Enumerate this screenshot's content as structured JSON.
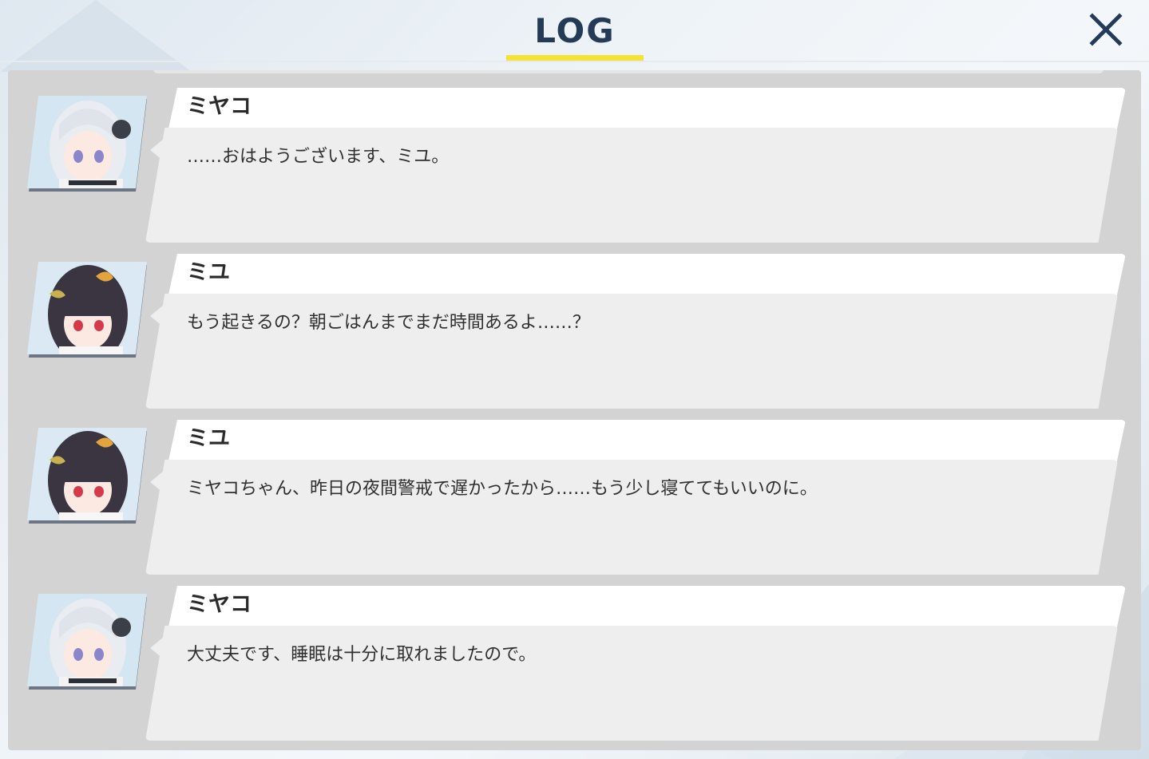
{
  "header": {
    "title": "LOG",
    "close_icon": "close-icon",
    "accent_color": "#f5e236",
    "title_color": "#243b57"
  },
  "log": {
    "entries": [
      {
        "speaker": "ミヤコ",
        "text": "……おはようございます、ミユ。",
        "portrait": "miyako-portrait"
      },
      {
        "speaker": "ミユ",
        "text": "もう起きるの？朝ごはんまでまだ時間あるよ……？",
        "portrait": "miyu-portrait"
      },
      {
        "speaker": "ミユ",
        "text": "ミヤコちゃん、昨日の夜間警戒で遅かったから……もう少し寝ててもいいのに。",
        "portrait": "miyu-portrait"
      },
      {
        "speaker": "ミヤコ",
        "text": "大丈夫です、睡眠は十分に取れましたので。",
        "portrait": "miyako-portrait"
      }
    ]
  }
}
